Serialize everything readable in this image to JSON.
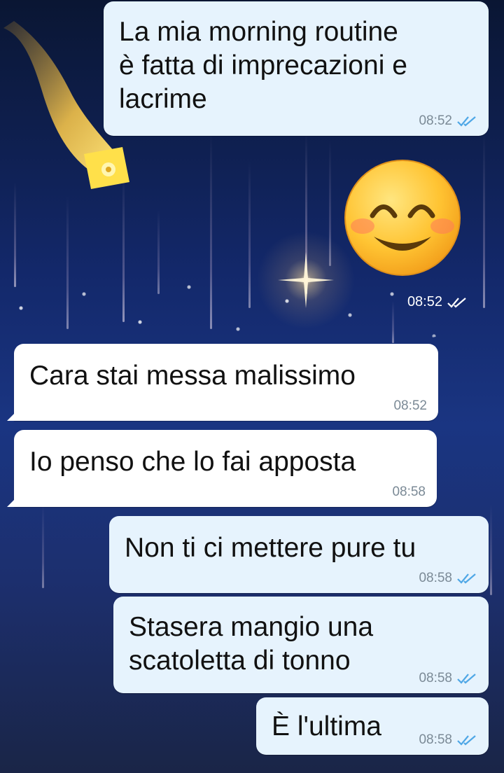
{
  "messages": [
    {
      "dir": "out",
      "text": "La mia morning routine\nè fatta di imprecazioni e\nlacrime",
      "time": "08:52",
      "status": "read"
    },
    {
      "dir": "out",
      "emoji": "smiling-face-with-smiling-eyes",
      "time": "08:52",
      "status": "read"
    },
    {
      "dir": "in",
      "text": "Cara stai messa malissimo",
      "time": "08:52"
    },
    {
      "dir": "in",
      "text": "Io penso che lo fai apposta",
      "time": "08:58"
    },
    {
      "dir": "out",
      "text": "Non ti ci mettere pure tu",
      "time": "08:58",
      "status": "read"
    },
    {
      "dir": "out",
      "text": "Stasera mangio una\nscatoletta di tonno",
      "time": "08:58",
      "status": "read"
    },
    {
      "dir": "out",
      "text": "È l'ultima",
      "time": "08:58",
      "status": "read"
    }
  ],
  "colors": {
    "outgoing_bubble": "#e6f3fd",
    "incoming_bubble": "#ffffff",
    "read_ticks": "#4fa7e6",
    "timestamp": "#7b8a96"
  }
}
